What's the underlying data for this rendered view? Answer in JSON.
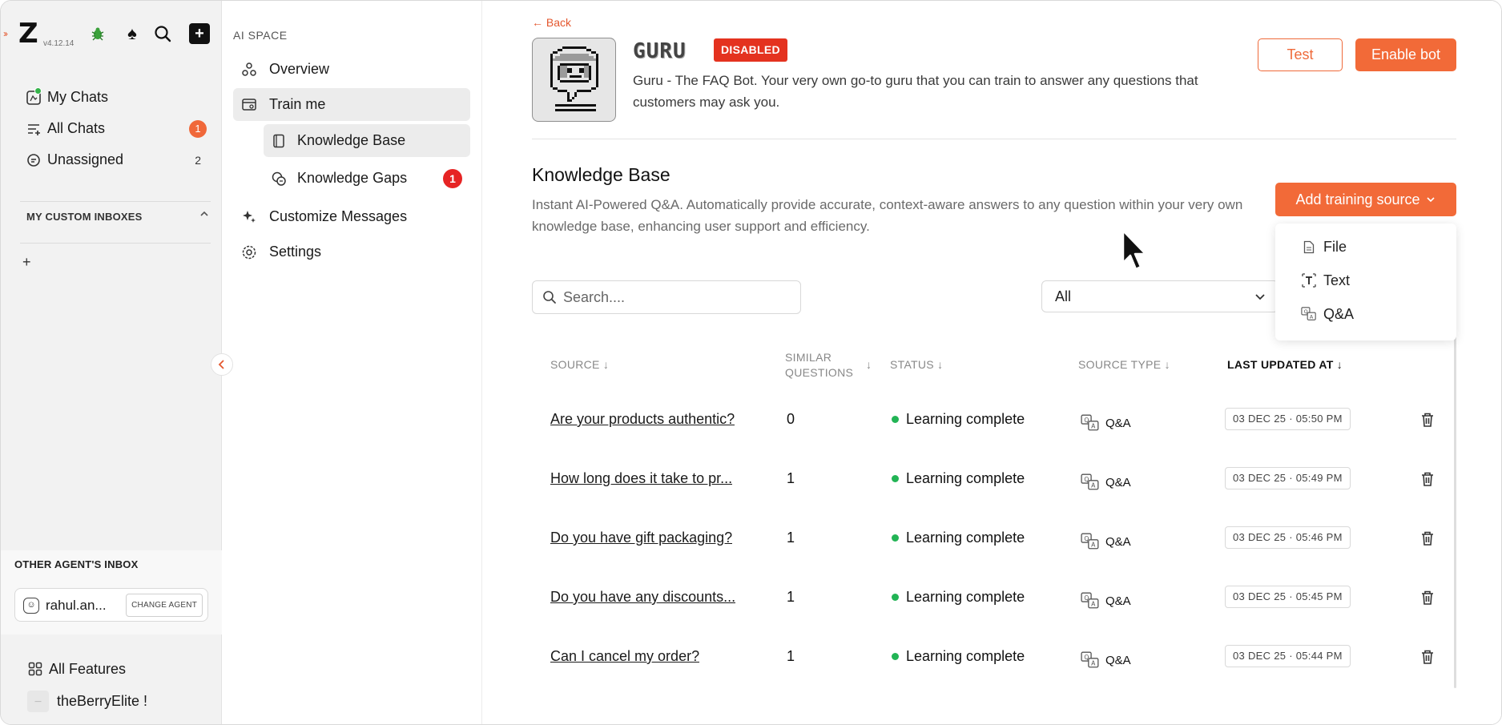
{
  "app": {
    "version": "v4.12.14"
  },
  "leftnav": {
    "items": [
      {
        "label": "My Chats",
        "count": ""
      },
      {
        "label": "All Chats",
        "count": "1"
      },
      {
        "label": "Unassigned",
        "count": "2"
      }
    ],
    "custom_inboxes_title": "MY CUSTOM INBOXES",
    "add_symbol": "+",
    "other_inbox_title": "OTHER AGENT'S INBOX",
    "agent_name": "rahul.an...",
    "change_agent_label": "CHANGE AGENT",
    "all_features_label": "All Features",
    "workspace_name": "theBerryElite !"
  },
  "aispace": {
    "title": "AI SPACE",
    "overview": "Overview",
    "train_me": "Train me",
    "knowledge_base": "Knowledge Base",
    "knowledge_gaps": "Knowledge Gaps",
    "knowledge_gaps_badge": "1",
    "customize_messages": "Customize Messages",
    "settings": "Settings"
  },
  "main": {
    "back_label": "← Back",
    "bot_name": "GURU",
    "status_badge": "DISABLED",
    "bot_description": "Guru - The FAQ Bot. Your very own go-to guru that you can train to answer any questions that customers may ask you.",
    "test_label": "Test",
    "enable_label": "Enable bot",
    "kb_title": "Knowledge Base",
    "kb_description": "Instant AI-Powered Q&A. Automatically provide accurate, context-aware answers to any question within your very own knowledge base, enhancing user support and efficiency.",
    "add_source_label": "Add training source",
    "dropdown_items": [
      "File",
      "Text",
      "Q&A"
    ],
    "search_placeholder": "Search....",
    "filter_value": "All",
    "columns": {
      "source": "SOURCE ↓",
      "similar_1": "SIMILAR",
      "similar_2": "QUESTIONS",
      "similar_arrow": "↓",
      "status": "STATUS ↓",
      "source_type": "SOURCE TYPE ↓",
      "last_updated": "LAST UPDATED AT ↓"
    },
    "rows": [
      {
        "source": "Are your products authentic?",
        "similar": "0",
        "status": "Learning complete",
        "type": "Q&A",
        "updated": "03 DEC 25 · 05:50 PM"
      },
      {
        "source": "How long does it take to pr...",
        "similar": "1",
        "status": "Learning complete",
        "type": "Q&A",
        "updated": "03 DEC 25 · 05:49 PM"
      },
      {
        "source": "Do you have gift packaging?",
        "similar": "1",
        "status": "Learning complete",
        "type": "Q&A",
        "updated": "03 DEC 25 · 05:46 PM"
      },
      {
        "source": "Do you have any discounts...",
        "similar": "1",
        "status": "Learning complete",
        "type": "Q&A",
        "updated": "03 DEC 25 · 05:45 PM"
      },
      {
        "source": "Can I cancel my order?",
        "similar": "1",
        "status": "Learning complete",
        "type": "Q&A",
        "updated": "03 DEC 25 · 05:44 PM"
      }
    ]
  },
  "colors": {
    "accent": "#f26a38",
    "danger": "#e4321f",
    "success": "#22b455"
  }
}
